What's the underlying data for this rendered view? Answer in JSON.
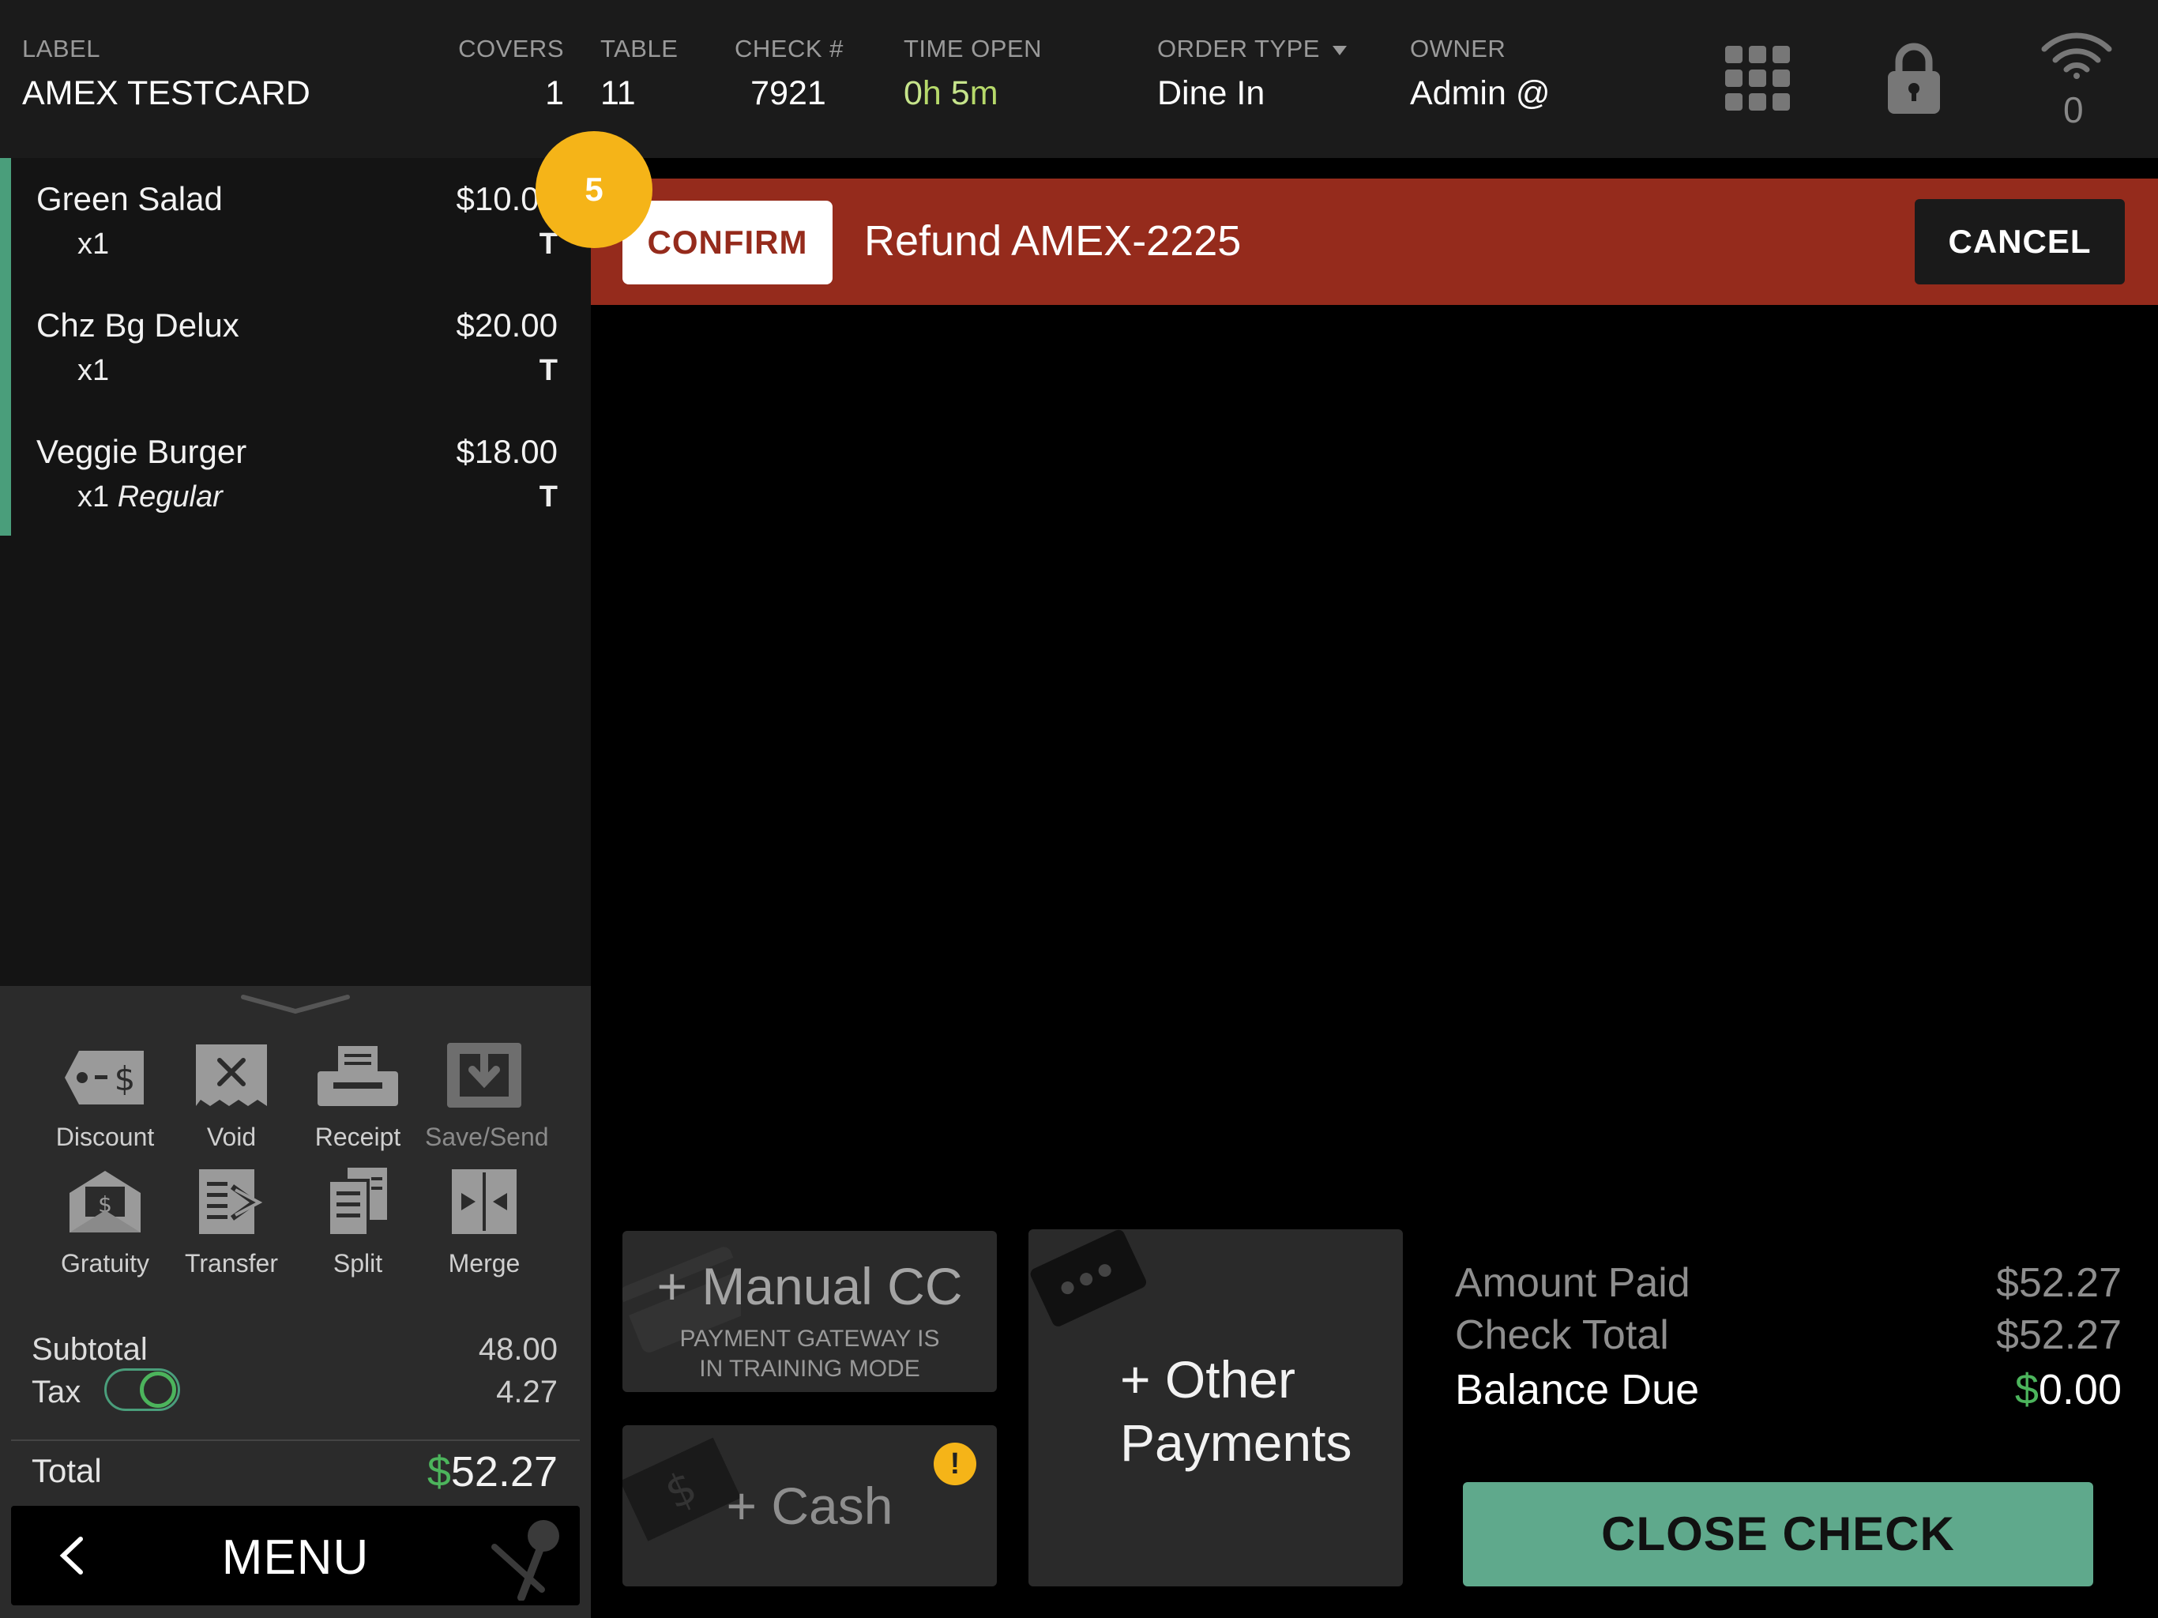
{
  "header": {
    "label": {
      "title": "LABEL",
      "value": "AMEX TESTCARD"
    },
    "covers": {
      "title": "COVERS",
      "value": "1"
    },
    "table": {
      "title": "TABLE",
      "value": "11"
    },
    "check": {
      "title": "CHECK #",
      "value": "7921"
    },
    "time_open": {
      "title": "TIME OPEN",
      "hours": "0",
      "h": "h",
      "minutes": "5",
      "m": "m"
    },
    "order_type": {
      "title": "ORDER TYPE",
      "value": "Dine In"
    },
    "owner": {
      "title": "OWNER",
      "value": "Admin @"
    },
    "wifi_count": "0"
  },
  "items": [
    {
      "name": "Green Salad",
      "price": "$10.00",
      "qty": "x1",
      "mod": "",
      "tax": "T"
    },
    {
      "name": "Chz Bg Delux",
      "price": "$20.00",
      "qty": "x1",
      "mod": "",
      "tax": "T"
    },
    {
      "name": "Veggie Burger",
      "price": "$18.00",
      "qty": "x1",
      "mod": "Regular",
      "tax": "T"
    }
  ],
  "badge": "5",
  "confirm_bar": {
    "confirm_label": "CONFIRM",
    "message": "Refund AMEX-2225",
    "cancel_label": "CANCEL"
  },
  "actions": [
    {
      "label": "Discount",
      "icon": "discount-tag-icon"
    },
    {
      "label": "Void",
      "icon": "void-receipt-icon"
    },
    {
      "label": "Receipt",
      "icon": "printer-icon"
    },
    {
      "label": "Save/Send",
      "icon": "save-send-icon"
    },
    {
      "label": "Gratuity",
      "icon": "gratuity-envelope-icon"
    },
    {
      "label": "Transfer",
      "icon": "transfer-icon"
    },
    {
      "label": "Split",
      "icon": "split-icon"
    },
    {
      "label": "Merge",
      "icon": "merge-icon"
    }
  ],
  "summary": {
    "subtotal_label": "Subtotal",
    "subtotal": "48.00",
    "tax_label": "Tax",
    "tax": "4.27",
    "total_label": "Total",
    "total_currency": "$",
    "total": "52.27"
  },
  "menu_label": "MENU",
  "payments": {
    "manual_cc": "+ Manual CC",
    "manual_note_1": "PAYMENT GATEWAY IS",
    "manual_note_2": "IN TRAINING MODE",
    "cash": "+ Cash",
    "cash_warning": "!",
    "other_1": "+ Other",
    "other_2": "Payments"
  },
  "amounts": {
    "paid_label": "Amount Paid",
    "paid": "$52.27",
    "check_total_label": "Check Total",
    "check_total": "$52.27",
    "balance_label": "Balance Due",
    "balance_currency": "$",
    "balance": "0.00"
  },
  "close_check_label": "CLOSE CHECK",
  "colors": {
    "accent_green": "#5fa98c",
    "confirm_red": "#952b1c",
    "badge_yellow": "#f5b418"
  }
}
